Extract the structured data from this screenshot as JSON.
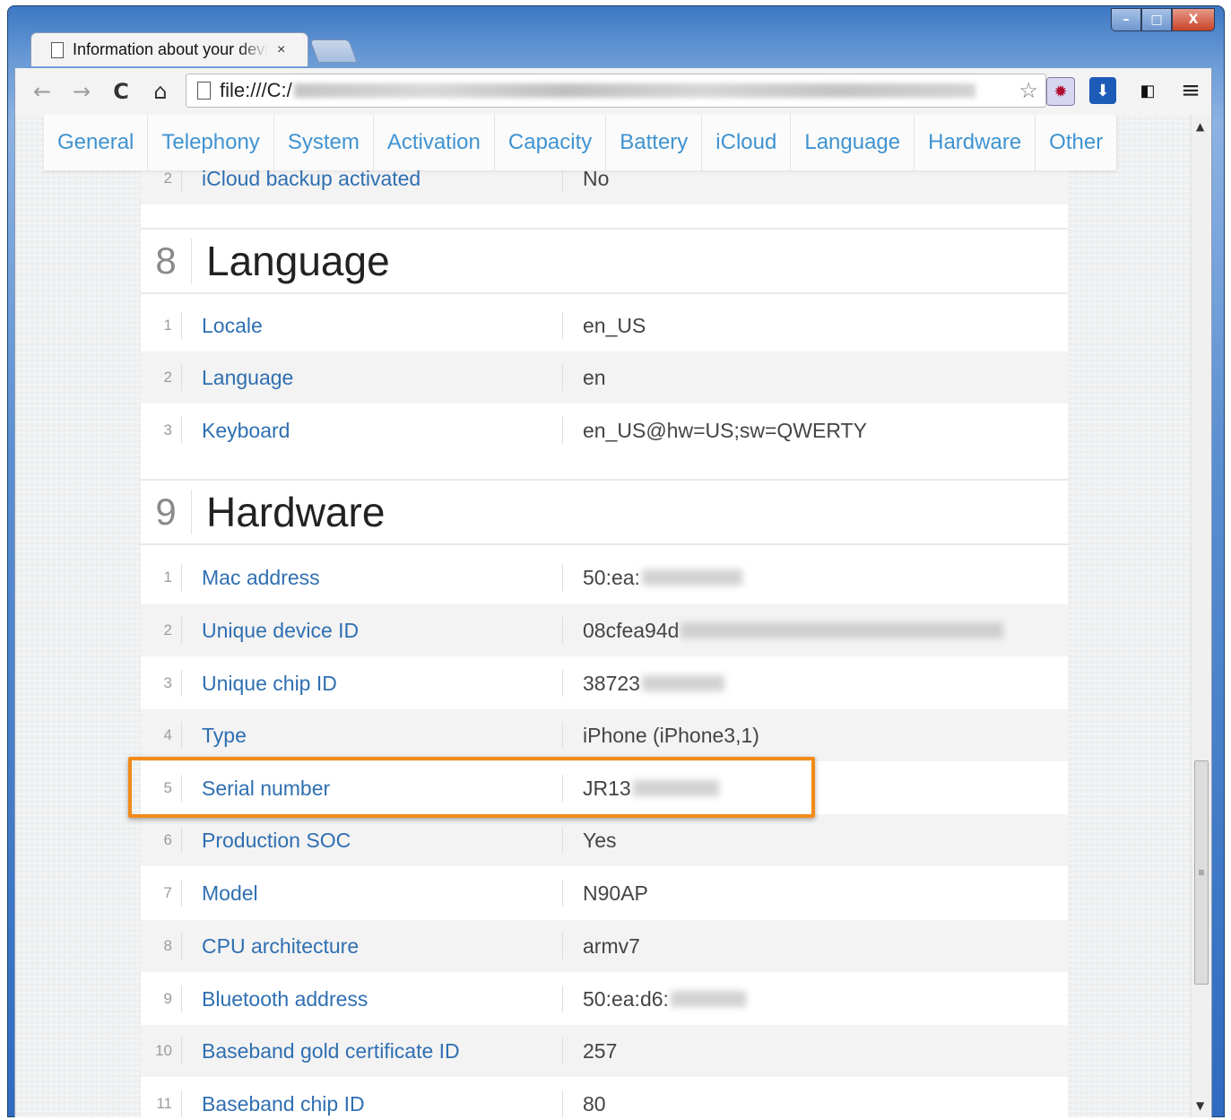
{
  "window": {
    "controls": {
      "minimize": "–",
      "maximize": "□",
      "close": "X"
    }
  },
  "browser": {
    "tab_title": "Information about your device",
    "tab_close": "×",
    "url_prefix": "file:///C:/",
    "nav": {
      "back": "←",
      "forward": "→",
      "reload": "C",
      "home": "⌂"
    },
    "bookmark_star": "☆",
    "menu": "≡",
    "icons": [
      "page-icon",
      "star-icon",
      "extension-icon",
      "download-icon",
      "device-icon",
      "menu-icon"
    ]
  },
  "topnav": {
    "items": [
      "General",
      "Telephony",
      "System",
      "Activation",
      "Capacity",
      "Battery",
      "iCloud",
      "Language",
      "Hardware",
      "Other"
    ]
  },
  "prev_row": {
    "num": "2",
    "key": "iCloud backup activated",
    "value": "No"
  },
  "sections": [
    {
      "number": "8",
      "title": "Language",
      "rows": [
        {
          "num": "1",
          "key": "Locale",
          "value": "en_US"
        },
        {
          "num": "2",
          "key": "Language",
          "value": "en"
        },
        {
          "num": "3",
          "key": "Keyboard",
          "value": "en_US@hw=US;sw=QWERTY"
        }
      ]
    },
    {
      "number": "9",
      "title": "Hardware",
      "rows": [
        {
          "num": "1",
          "key": "Mac address",
          "value": "50:ea:"
        },
        {
          "num": "2",
          "key": "Unique device ID",
          "value": "08cfea94d"
        },
        {
          "num": "3",
          "key": "Unique chip ID",
          "value": "38723"
        },
        {
          "num": "4",
          "key": "Type",
          "value": "iPhone (iPhone3,1)"
        },
        {
          "num": "5",
          "key": "Serial number",
          "value": "JR13"
        },
        {
          "num": "6",
          "key": "Production SOC",
          "value": "Yes"
        },
        {
          "num": "7",
          "key": "Model",
          "value": "N90AP"
        },
        {
          "num": "8",
          "key": "CPU architecture",
          "value": "armv7"
        },
        {
          "num": "9",
          "key": "Bluetooth address",
          "value": "50:ea:d6:"
        },
        {
          "num": "10",
          "key": "Baseband gold certificate ID",
          "value": "257"
        },
        {
          "num": "11",
          "key": "Baseband chip ID",
          "value": "80"
        }
      ]
    }
  ],
  "colors": {
    "link": "#2f6fb1",
    "nav": "#3f93d1",
    "highlight": "#f28a1a"
  }
}
